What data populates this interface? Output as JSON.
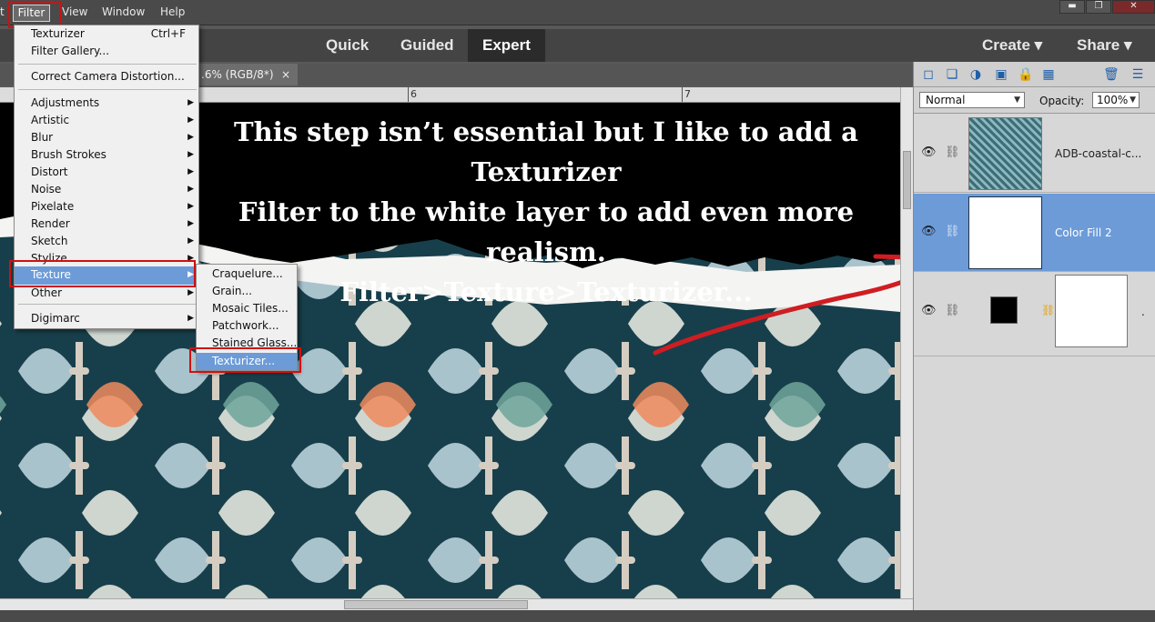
{
  "menubar": {
    "items": [
      "t",
      "Filter",
      "View",
      "Window",
      "Help"
    ]
  },
  "window_controls": {
    "minimize": "▬",
    "restore": "❐",
    "close": "✕"
  },
  "modes": {
    "quick": "Quick",
    "guided": "Guided",
    "expert": "Expert"
  },
  "actions": {
    "create": "Create ▾",
    "share": "Share ▾"
  },
  "document": {
    "tab_label": ".6% (RGB/8*)",
    "tab_close": "×"
  },
  "ruler": {
    "marks": [
      "6",
      "7"
    ]
  },
  "annotation": {
    "line1": "This step isn’t essential but I like to add a Texturizer",
    "line2": "Filter to the white layer to add even more realism.",
    "line3": "Filter>Texture>Texturizer..."
  },
  "filter_menu": {
    "texturizer": "Texturizer",
    "texturizer_shortcut": "Ctrl+F",
    "filter_gallery": "Filter Gallery...",
    "correct_camera": "Correct Camera Distortion...",
    "items": [
      "Adjustments",
      "Artistic",
      "Blur",
      "Brush Strokes",
      "Distort",
      "Noise",
      "Pixelate",
      "Render",
      "Sketch",
      "Stylize",
      "Texture",
      "Other"
    ],
    "digimarc": "Digimarc"
  },
  "texture_submenu": {
    "items": [
      "Craquelure...",
      "Grain...",
      "Mosaic Tiles...",
      "Patchwork...",
      "Stained Glass...",
      "Texturizer..."
    ]
  },
  "layers_panel": {
    "blend_mode": "Normal",
    "opacity_label": "Opacity:",
    "opacity_value": "100%",
    "layers": [
      {
        "name": "ADB-coastal-c..."
      },
      {
        "name": "Color Fill 2"
      },
      {
        "name": "."
      }
    ]
  },
  "colors": {
    "accent": "#6c9bd8",
    "highlight_red": "#d01010",
    "canvas_teal": "#173f4b",
    "orange": "#f08a5d"
  }
}
